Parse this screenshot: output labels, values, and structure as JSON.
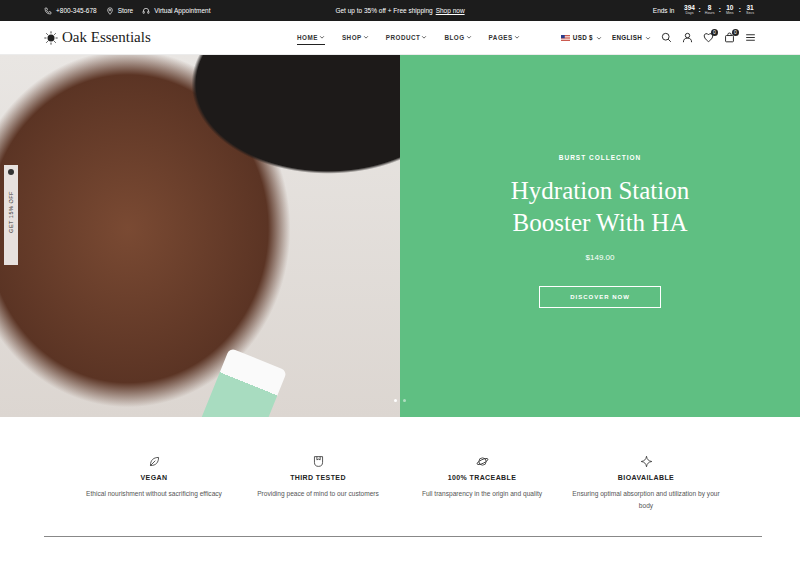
{
  "topbar": {
    "phone": "+800-345-678",
    "store": "Store",
    "appointment": "Virtual Appointment",
    "promo": {
      "text": "Get up to 35% off + Free shipping",
      "link": "Shop now"
    },
    "countdown": {
      "label": "Ends in",
      "separator": ":",
      "units": [
        {
          "value": "394",
          "unit": "Days"
        },
        {
          "value": "8",
          "unit": "Hours"
        },
        {
          "value": "10",
          "unit": "Mins"
        },
        {
          "value": "31",
          "unit": "Secs"
        }
      ]
    }
  },
  "header": {
    "logo": "Oak Essentials",
    "nav": [
      {
        "label": "HOME",
        "selected": true
      },
      {
        "label": "SHOP",
        "selected": false
      },
      {
        "label": "PRODUCT",
        "selected": false
      },
      {
        "label": "BLOG",
        "selected": false
      },
      {
        "label": "PAGES",
        "selected": false
      }
    ],
    "currency": "USD $",
    "language": "ENGLISH",
    "wishlist_count": "0",
    "cart_count": "0"
  },
  "side_tab": {
    "label": "GET 15% OFF"
  },
  "hero": {
    "eyebrow": "BURST COLLECTION",
    "title": "Hydration Station Booster With HA",
    "price": "$149.00",
    "button": "DISCOVER NOW",
    "slides": [
      {
        "selected": true
      },
      {
        "selected": false
      }
    ]
  },
  "features": [
    {
      "title": "VEGAN",
      "text": "Ethical nourishment without sacrificing efficacy"
    },
    {
      "title": "THIRD TESTED",
      "text": "Providing peace of mind to our customers"
    },
    {
      "title": "100% TRACEABLE",
      "text": "Full transparency in the origin and quality"
    },
    {
      "title": "BIOAVAILABLE",
      "text": "Ensuring optimal absorption and utilization by your body"
    }
  ]
}
